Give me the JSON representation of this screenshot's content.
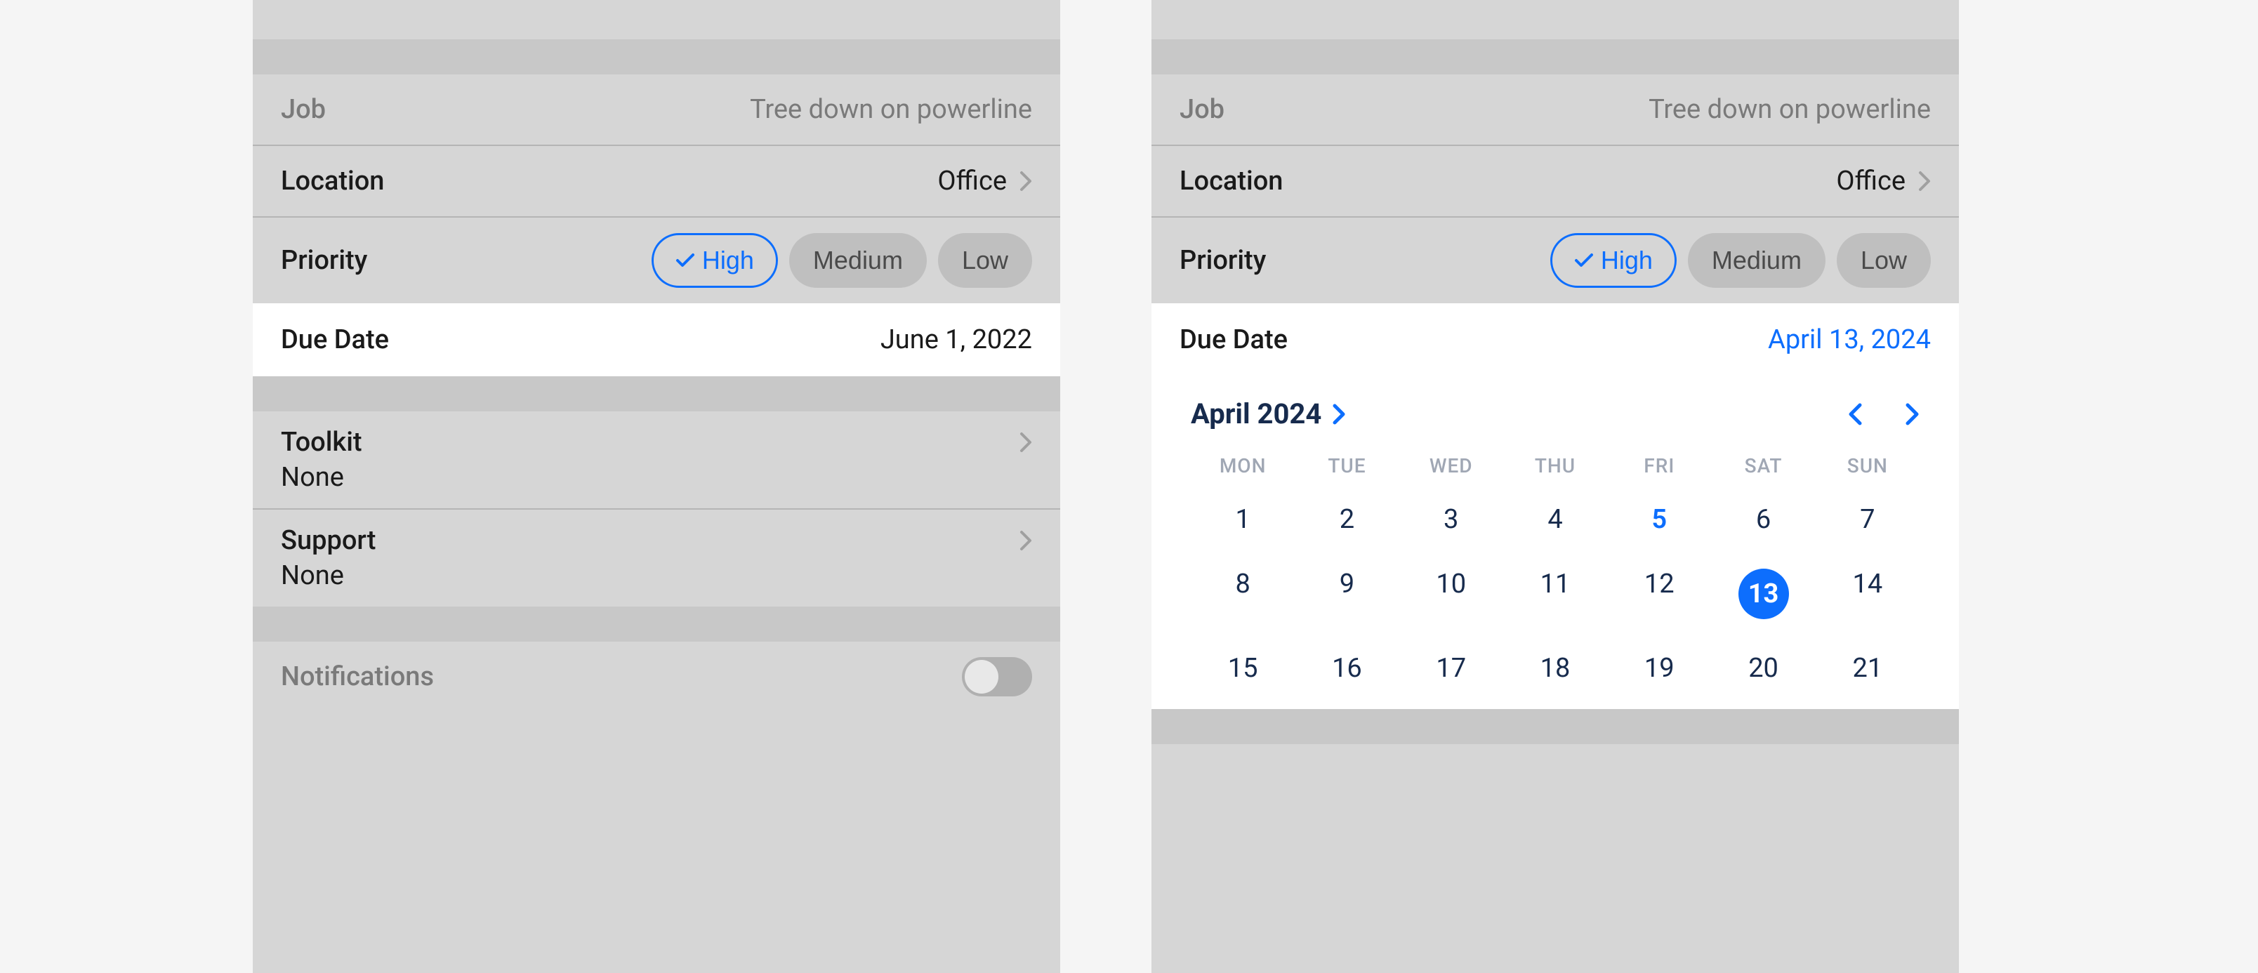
{
  "left": {
    "job_label": "Job",
    "job_value": "Tree down on powerline",
    "location_label": "Location",
    "location_value": "Office",
    "priority_label": "Priority",
    "priority_options": {
      "high": "High",
      "medium": "Medium",
      "low": "Low"
    },
    "due_label": "Due Date",
    "due_value": "June 1, 2022",
    "toolkit_label": "Toolkit",
    "toolkit_value": "None",
    "support_label": "Support",
    "support_value": "None",
    "notifications_label": "Notifications"
  },
  "right": {
    "job_label": "Job",
    "job_value": "Tree down on powerline",
    "location_label": "Location",
    "location_value": "Office",
    "priority_label": "Priority",
    "priority_options": {
      "high": "High",
      "medium": "Medium",
      "low": "Low"
    },
    "due_label": "Due Date",
    "due_value": "April 13, 2024",
    "calendar": {
      "month_label": "April 2024",
      "dow": [
        "MON",
        "TUE",
        "WED",
        "THU",
        "FRI",
        "SAT",
        "SUN"
      ],
      "days": [
        1,
        2,
        3,
        4,
        5,
        6,
        7,
        8,
        9,
        10,
        11,
        12,
        13,
        14,
        15,
        16,
        17,
        18,
        19,
        20,
        21
      ],
      "today": 5,
      "selected": 13
    }
  }
}
